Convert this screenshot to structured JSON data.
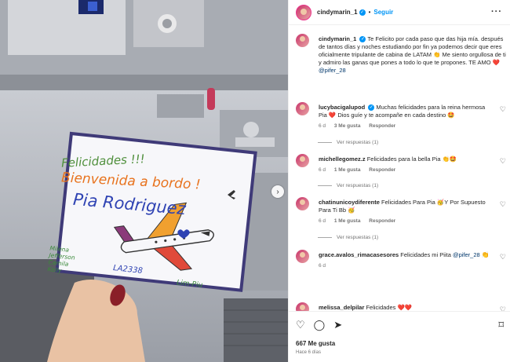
{
  "post": {
    "username": "cindymarin_1",
    "follow_label": "Seguir",
    "more_icon": "more-horizontal-icon"
  },
  "photo_card": {
    "line1": "Felicidades !!!",
    "line2": "Bienvenida a bordo !",
    "line3": "Pia Rodriguez",
    "names": [
      "Milena",
      "Jefferson",
      "Camila",
      "Kelly"
    ],
    "flight": "LA2338",
    "route": "Lim-Piu"
  },
  "caption": {
    "username": "cindymarin_1",
    "text": "Te Felicito por cada paso que das hija mía. después de tantos días y noches estudiando por fin ya podemos decir que eres oficialmente tripulante de cabina de LATAM 👏 Me siento orgullosa de ti y admiro las ganas que pones a todo lo que te propones. TE AMO ❤️",
    "mention": "@pifer_28"
  },
  "comments": [
    {
      "username": "lucybacigalupod",
      "verified": true,
      "text": "Muchas felicidades para la reina hermosa Pia ❤️ Dios guíe y te acompañe en cada destino 🤩",
      "time": "6 d",
      "likes": "3 Me gusta",
      "reply": "Responder",
      "view_replies": "Ver respuestas (1)"
    },
    {
      "username": "michellegomez.z",
      "text": "Felicidades para la bella Pia 👏🤩",
      "time": "6 d",
      "likes": "1 Me gusta",
      "reply": "Responder",
      "view_replies": "Ver respuestas (1)"
    },
    {
      "username": "chatinunicoydiferente",
      "text": "Felicidades Para Pia 🥳Y Por Supuesto Para Ti Bb 🥳",
      "time": "6 d",
      "likes": "1 Me gusta",
      "reply": "Responder",
      "view_replies": "Ver respuestas (1)"
    },
    {
      "username": "grace.avalos_rimacasesores",
      "text": "Felicidades mi Piita",
      "mention": "@pifer_28",
      "emoji": "👏",
      "time": "6 d"
    },
    {
      "username": "melissa_delpilar",
      "text": "Felicidades ❤️❤️"
    }
  ],
  "footer": {
    "likes": "667 Me gusta",
    "ago": "Hace 6 días"
  },
  "colors": {
    "link": "#0095f6",
    "muted": "#737373",
    "card_border": "#3f3a78"
  }
}
